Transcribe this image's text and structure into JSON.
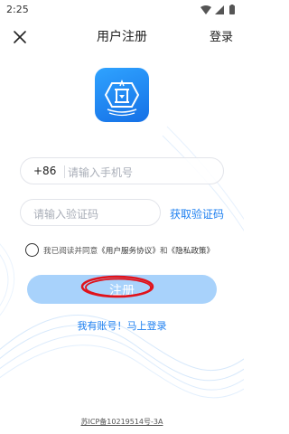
{
  "status_bar": {
    "time": "2:25"
  },
  "header": {
    "title": "用户注册",
    "login_label": "登录"
  },
  "form": {
    "country_code": "+86",
    "phone_placeholder": "请输入手机号",
    "code_placeholder": "请输入验证码",
    "get_code_label": "获取验证码",
    "agreement": {
      "prefix": "我已阅读并同意",
      "service_link": "《用户服务协议》",
      "conjunction": "和",
      "privacy_link": "《隐私政策》"
    },
    "register_label": "注册",
    "have_account_label": "我有账号！马上登录"
  },
  "footer": {
    "icp": "苏ICP备10219514号-3A"
  },
  "colors": {
    "accent": "#1f80f0",
    "button": "#a8d2fb",
    "annotation": "#e0121b",
    "logo": "#1570e6"
  }
}
